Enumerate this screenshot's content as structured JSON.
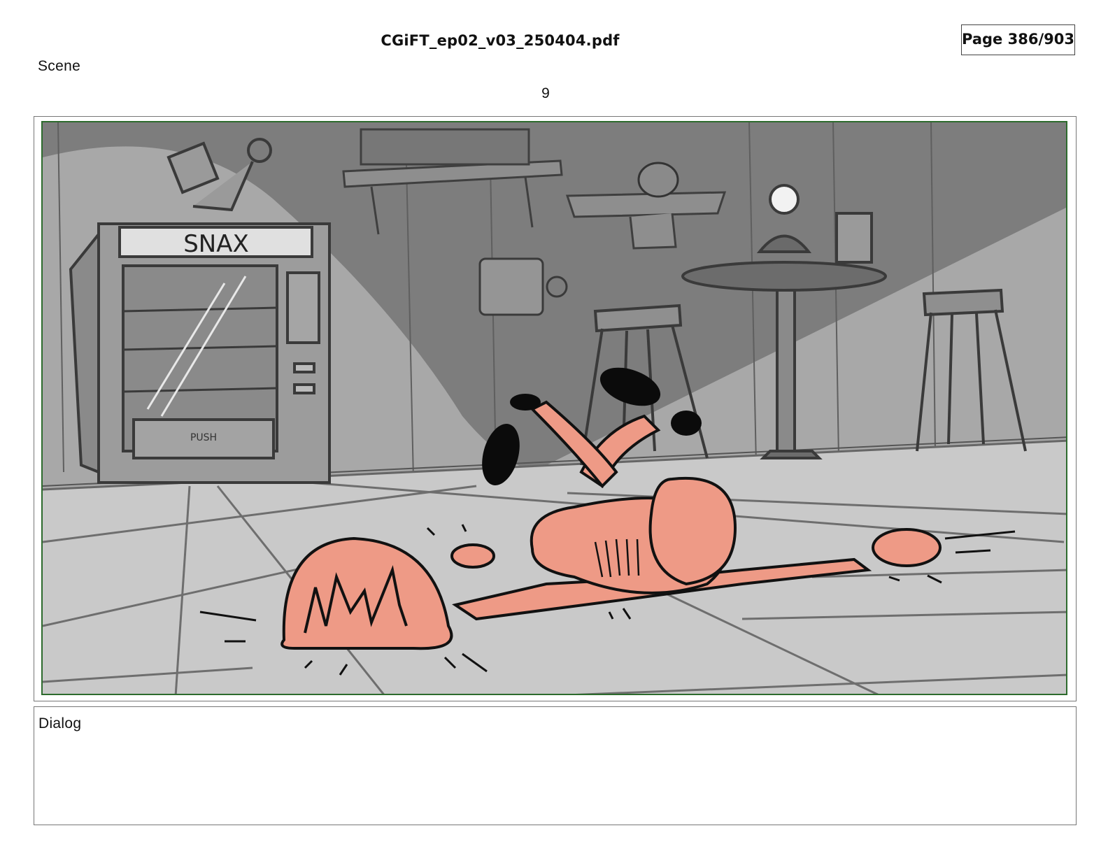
{
  "header": {
    "file_name": "CGiFT_ep02_v03_250404.pdf",
    "page_indicator": "Page 386/903"
  },
  "scene": {
    "label": "Scene",
    "panel_number": "9"
  },
  "panel_art": {
    "sign_text": "SNAX",
    "machine_push_text": "PUSH",
    "colors": {
      "wall_dark": "#7b7b7b",
      "wall_light": "#a9a9a9",
      "floor": "#c8c8c8",
      "character": "#ee9a86",
      "frame_border": "#2d6b2d"
    }
  },
  "dialog": {
    "label": "Dialog",
    "text": ""
  }
}
